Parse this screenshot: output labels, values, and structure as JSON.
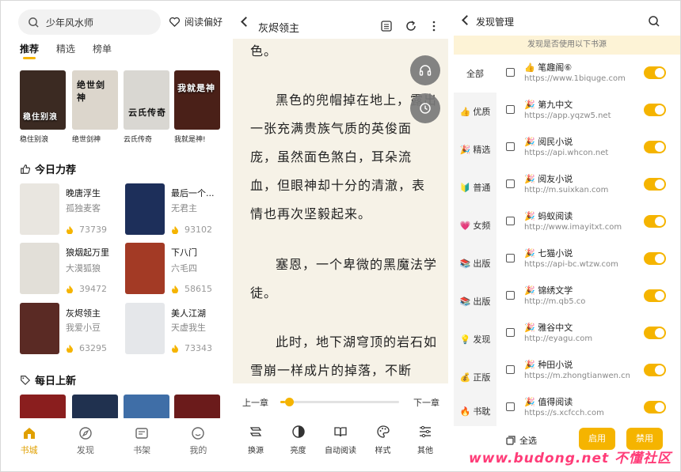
{
  "bookstore": {
    "search_placeholder": "少年风水师",
    "preference_label": "阅读偏好",
    "tabs": [
      "推荐",
      "精选",
      "榜单"
    ],
    "top_books": [
      {
        "label": "稳住别浪",
        "cover_text": "稳住别浪",
        "color": "#3b2a22"
      },
      {
        "label": "绝世剑神",
        "cover_text": "绝世剑神",
        "color": "#dcd6cc"
      },
      {
        "label": "云氏传奇",
        "cover_text": "云氏传奇",
        "color": "#d9d7d2"
      },
      {
        "label": "我就是神!",
        "cover_text": "我就是神",
        "color": "#4a2018"
      }
    ],
    "today_title": "今日力荐",
    "recommend": [
      {
        "title": "晚唐浮生",
        "author": "孤独麦客",
        "count": "73739",
        "color": "#e9e6e0"
      },
      {
        "title": "最后一个...",
        "author": "无君主",
        "count": "93102",
        "color": "#1d2f5a"
      },
      {
        "title": "狼烟起万里",
        "author": "大漠狐狼",
        "count": "39472",
        "color": "#e2dfd8"
      },
      {
        "title": "下八门",
        "author": "六毛四",
        "count": "58615",
        "color": "#a33a25"
      },
      {
        "title": "灰烬领主",
        "author": "我爱小豆",
        "count": "63295",
        "color": "#5a2a24"
      },
      {
        "title": "美人江湖",
        "author": "天虚我生",
        "count": "73343",
        "color": "#e5e7ea"
      }
    ],
    "daily_title": "每日上新",
    "daily_colors": [
      "#8a1e1e",
      "#20314f",
      "#3f6ea7",
      "#6b1b1b"
    ],
    "nav": [
      "书城",
      "发现",
      "书架",
      "我的"
    ]
  },
  "reader": {
    "book_title": "灰烬领主",
    "paragraphs": [
      "色。",
      "黑色的兜帽掉在地上，露出一张充满贵族气质的英俊面庞，虽然面色煞白，耳朵流血，但眼神却十分的清澈，表情也再次坚毅起来。",
      "塞恩，一个卑微的黑魔法学徒。",
      "此时，地下湖穹顶的岩石如雪崩一样成片的掉落，不断"
    ],
    "prev_chapter": "上一章",
    "next_chapter": "下一章",
    "progress": 0.04,
    "tools": [
      "换源",
      "亮度",
      "自动阅读",
      "样式",
      "其他"
    ]
  },
  "discover": {
    "title": "发现管理",
    "banner": "发现是否使用以下书源",
    "categories": [
      {
        "icon": "",
        "label": "全部"
      },
      {
        "icon": "👍",
        "label": "优质"
      },
      {
        "icon": "🎉",
        "label": "精选"
      },
      {
        "icon": "🔰",
        "label": "普通"
      },
      {
        "icon": "💗",
        "label": "女频"
      },
      {
        "icon": "📚",
        "label": "出版"
      },
      {
        "icon": "📚",
        "label": "出版"
      },
      {
        "icon": "💡",
        "label": "发现"
      },
      {
        "icon": "💰",
        "label": "正版"
      },
      {
        "icon": "🔥",
        "label": "书耽"
      }
    ],
    "sources": [
      {
        "name": "👍 笔趣阁⑥",
        "url": "https://www.1biqugе.com"
      },
      {
        "name": "🎉 第九中文",
        "url": "https://app.yqzw5.net"
      },
      {
        "name": "🎉 阅民小说",
        "url": "https://api.whcon.net"
      },
      {
        "name": "🎉 阅友小说",
        "url": "http://m.suixkan.com"
      },
      {
        "name": "🎉 蚂蚁阅读",
        "url": "http://www.imayitxt.com"
      },
      {
        "name": "🎉 七猫小说",
        "url": "https://api-bc.wtzw.com"
      },
      {
        "name": "🎉 锦绣文学",
        "url": "http://m.qb5.co"
      },
      {
        "name": "🎉 雅谷中文",
        "url": "http://eyagu.com"
      },
      {
        "name": "🎉 种田小说",
        "url": "https://m.zhongtianwen.cn"
      },
      {
        "name": "🎉 值得阅读",
        "url": "https://s.xcfcch.com"
      }
    ],
    "select_all": "全选",
    "enable_label": "启用",
    "disable_label": "禁用",
    "accent": "#f5b400"
  },
  "watermark": "www.budong.net 不懂社区"
}
